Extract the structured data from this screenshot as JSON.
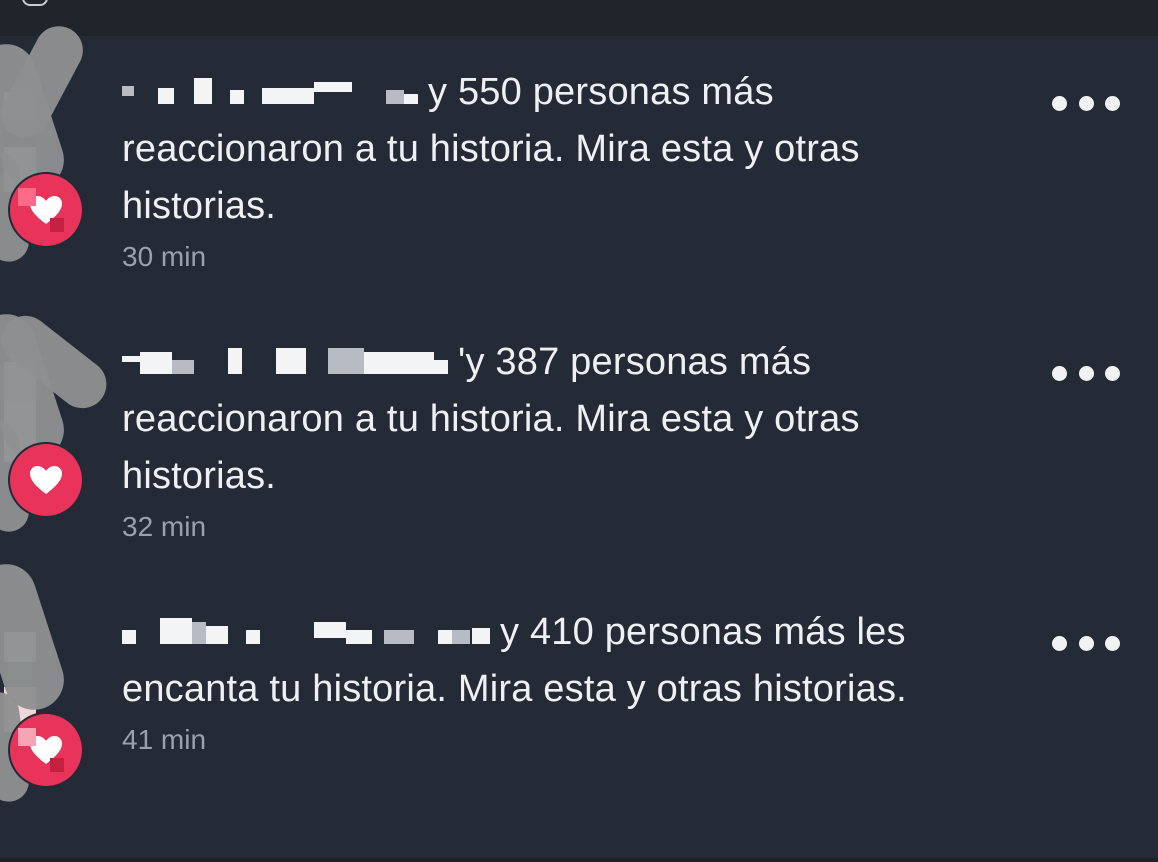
{
  "notifications": [
    {
      "message": "y 550 personas más reaccionaron a tu historia. Mira esta y otras historias.",
      "time": "30 min",
      "reaction": "heart-icon"
    },
    {
      "message": "'y 387 personas más reaccionaron a tu historia. Mira esta y otras historias.",
      "time": "32 min",
      "reaction": "heart-icon"
    },
    {
      "message": "y 410 personas más les encanta tu historia. Mira esta y otras historias.",
      "time": "41 min",
      "reaction": "heart-icon"
    }
  ],
  "colors": {
    "background": "#242b36",
    "text": "#eef0f3",
    "timestamp": "#9aa1ab",
    "reaction_badge": "#e8335a"
  }
}
